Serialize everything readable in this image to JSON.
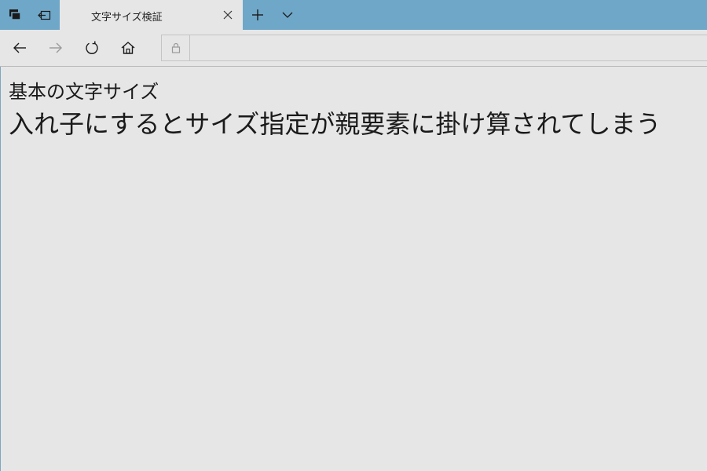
{
  "window": {
    "titlebar_color": "#6fa7c8",
    "background_color": "#e6e6e6"
  },
  "titlebar": {
    "left_icons": [
      "tabs-aside-icon",
      "set-tabs-aside-icon"
    ],
    "tab": {
      "title": "文字サイズ検証"
    },
    "new_tab_icon": "plus-icon",
    "tab_list_icon": "chevron-down-icon"
  },
  "toolbar": {
    "buttons": [
      "back-arrow-icon",
      "forward-arrow-icon",
      "refresh-icon",
      "home-icon"
    ],
    "address": {
      "value": "",
      "lock_icon": "lock-icon"
    }
  },
  "page": {
    "line1": "基本の文字サイズ",
    "line2": "入れ子にするとサイズ指定が親要素に掛け算されてしまう"
  }
}
